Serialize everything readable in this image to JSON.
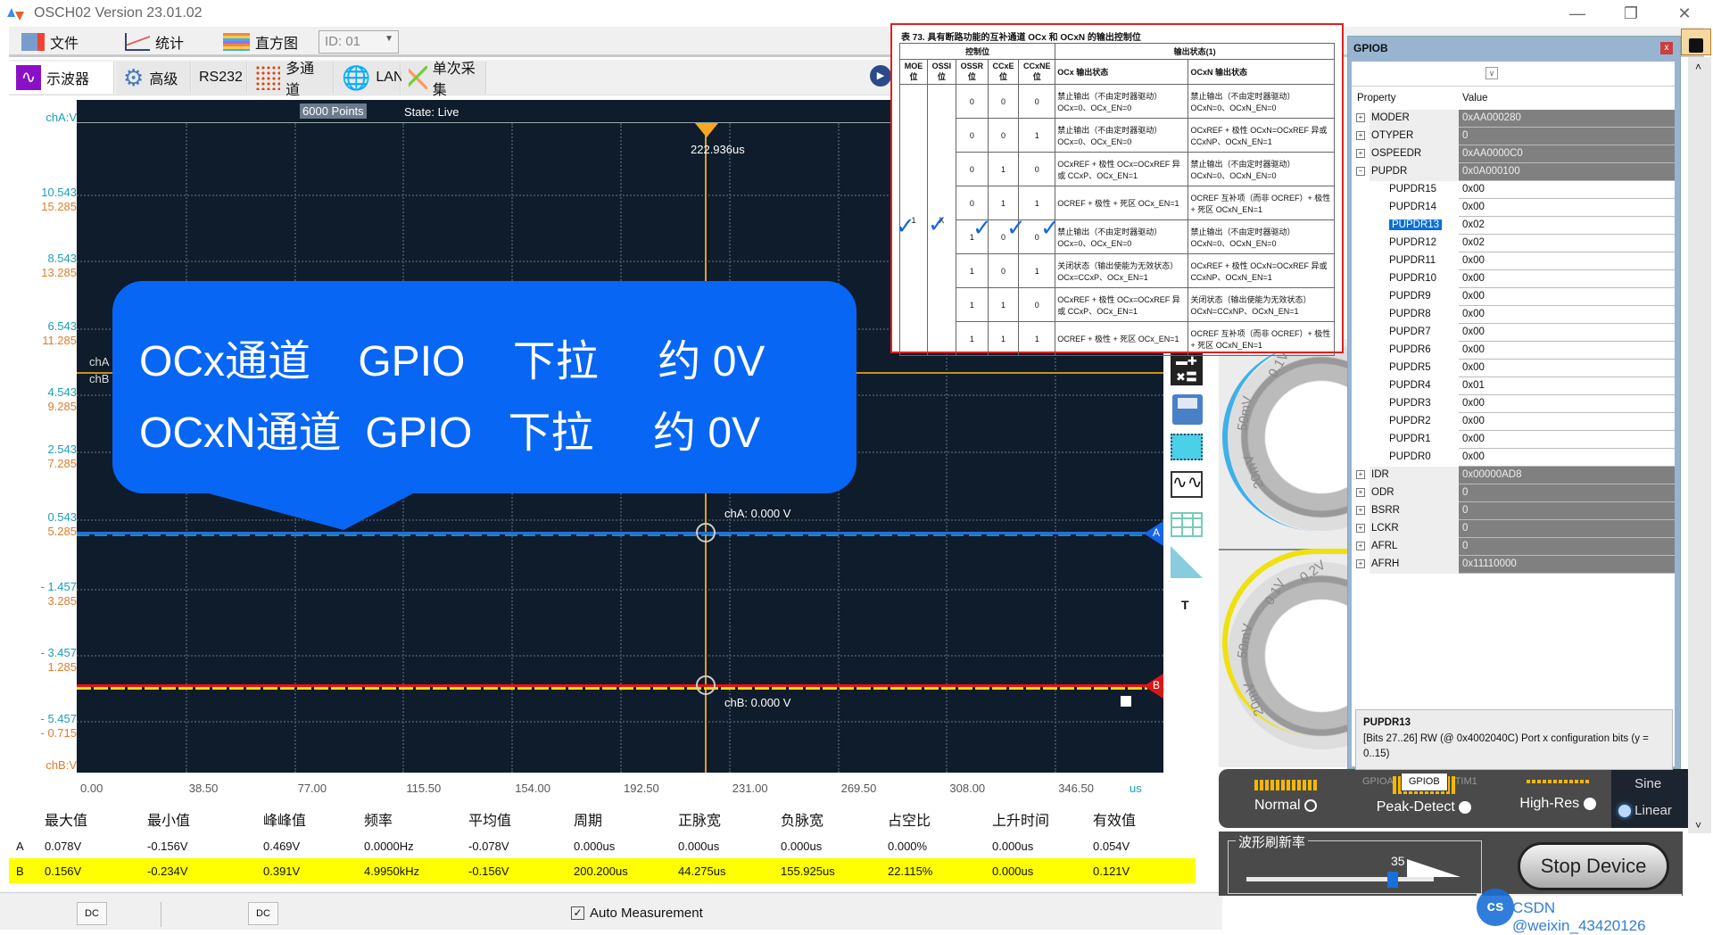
{
  "window": {
    "title": "OSCH02  Version 23.01.02"
  },
  "menu": {
    "items": [
      {
        "label": "文件",
        "icon": "file-icon"
      },
      {
        "label": "统计",
        "icon": "chart-icon"
      },
      {
        "label": "直方图",
        "icon": "histogram-icon"
      }
    ],
    "id_select": "ID: 01"
  },
  "tabs": [
    {
      "label": "示波器",
      "icon": "oscilloscope-icon",
      "active": true
    },
    {
      "label": "高级",
      "icon": "gear-icon"
    },
    {
      "label": "RS232",
      "icon": ""
    },
    {
      "label": "多通道",
      "icon": "grid-icon"
    },
    {
      "label": "LAN",
      "icon": "globe-icon"
    },
    {
      "label": "单次采集",
      "icon": "single-capture-icon"
    }
  ],
  "scope": {
    "points": "6000 Points",
    "state": "State: Live",
    "trigger_time": "222.936us",
    "chA_label": "chA",
    "chB_label": "chB",
    "chA_readout": "chA: 0.000 V",
    "chB_readout": "chB: 0.000 V",
    "marker_a": "A",
    "marker_b": "B",
    "y_axis_a_title": "chA:V",
    "y_axis_b_title": "chB:V",
    "y_ticks_a": [
      "10.543",
      "8.543",
      "6.543",
      "4.543",
      "2.543",
      "0.543",
      "- 1.457",
      "- 3.457",
      "- 5.457"
    ],
    "y_ticks_b": [
      "15.285",
      "13.285",
      "11.285",
      "9.285",
      "7.285",
      "5.285",
      "3.285",
      "1.285",
      "- 0.715"
    ],
    "x_ticks": [
      "0.00",
      "38.50",
      "77.00",
      "115.50",
      "154.00",
      "192.50",
      "231.00",
      "269.50",
      "308.00",
      "346.50"
    ],
    "x_unit": "us"
  },
  "annotation": {
    "line1": "OCx通道    GPIO    下拉     约 0V",
    "line2": "OCxN通道  GPIO   下拉     约 0V"
  },
  "measurements": {
    "headers": [
      "最大值",
      "最小值",
      "峰峰值",
      "频率",
      "平均值",
      "周期",
      "正脉宽",
      "负脉宽",
      "占空比",
      "上升时间",
      "有效值"
    ],
    "rows": [
      {
        "ch": "A",
        "values": [
          "0.078V",
          "-0.156V",
          "0.469V",
          "0.0000Hz",
          "-0.078V",
          "0.000us",
          "0.000us",
          "0.000us",
          "0.000%",
          "0.000us",
          "0.054V"
        ]
      },
      {
        "ch": "B",
        "values": [
          "0.156V",
          "-0.234V",
          "0.391V",
          "4.9950kHz",
          "-0.156V",
          "200.200us",
          "44.275us",
          "155.925us",
          "22.115%",
          "0.000us",
          "0.121V"
        ]
      }
    ]
  },
  "bottom": {
    "coupling_a": "DC",
    "coupling_b": "DC",
    "auto_measurement": "Auto Measurement",
    "auto_checked": "✓"
  },
  "knobs": {
    "a": {
      "labels": [
        "0.1V",
        "50mV",
        "20mV"
      ],
      "color": "#3fb0e8"
    },
    "b": {
      "labels": [
        "0.2V",
        "0.1V",
        "50mV",
        "20mV"
      ],
      "color": "#f0e010"
    }
  },
  "acquisition": {
    "modes": [
      "Normal",
      "Peak-Detect",
      "High-Res"
    ],
    "interp": [
      "Sine",
      "Linear"
    ]
  },
  "refresh": {
    "label": "波形刷新率",
    "value": "35",
    "stop_button": "Stop Device"
  },
  "side_tools": {
    "t_label": "T"
  },
  "datasheet": {
    "caption": "表 73.        具有断路功能的互补通道 OCx 和 OCxN 的输出控制位",
    "group_ctrl": "控制位",
    "group_out": "输出状态(1)",
    "cols": [
      "MOE 位",
      "OSSI 位",
      "OSSR 位",
      "CCxE 位",
      "CCxNE 位",
      "OCx 输出状态",
      "OCxN 输出状态"
    ],
    "moe": "1",
    "ossi": "X",
    "rows": [
      {
        "ossr": "0",
        "ccxe": "0",
        "ccxne": "0",
        "ocx": "禁止输出（不由定时器驱动） OCx=0、OCx_EN=0",
        "ocxn": "禁止输出（不由定时器驱动） OCxN=0、OCxN_EN=0"
      },
      {
        "ossr": "0",
        "ccxe": "0",
        "ccxne": "1",
        "ocx": "禁止输出（不由定时器驱动） OCx=0、OCx_EN=0",
        "ocxn": "OCxREF + 极性 OCxN=OCxREF 异或 CCxNP、OCxN_EN=1"
      },
      {
        "ossr": "0",
        "ccxe": "1",
        "ccxne": "0",
        "ocx": "OCxREF + 极性 OCx=OCxREF 异或 CCxP、OCx_EN=1",
        "ocxn": "禁止输出（不由定时器驱动） OCxN=0、OCxN_EN=0"
      },
      {
        "ossr": "0",
        "ccxe": "1",
        "ccxne": "1",
        "ocx": "OCREF + 极性 + 死区 OCx_EN=1",
        "ocxn": "OCREF 互补项（而非 OCREF）+ 极性 + 死区 OCxN_EN=1"
      },
      {
        "ossr": "1",
        "ccxe": "0",
        "ccxne": "0",
        "ocx": "禁止输出（不由定时器驱动） OCx=0、OCx_EN=0",
        "ocxn": "禁止输出（不由定时器驱动） OCxN=0、OCxN_EN=0"
      },
      {
        "ossr": "1",
        "ccxe": "0",
        "ccxne": "1",
        "ocx": "关闭状态（输出使能为无效状态） OCx=CCxP、OCx_EN=1",
        "ocxn": "OCxREF + 极性 OCxN=OCxREF 异或 CCxNP、OCxN_EN=1"
      },
      {
        "ossr": "1",
        "ccxe": "1",
        "ccxne": "0",
        "ocx": "OCxREF + 极性 OCx=OCxREF 异或 CCxP、OCx_EN=1",
        "ocxn": "关闭状态（输出使能为无效状态） OCxN=CCxNP、OCxN_EN=1"
      },
      {
        "ossr": "1",
        "ccxe": "1",
        "ccxne": "1",
        "ocx": "OCREF + 极性 + 死区 OCx_EN=1",
        "ocxn": "OCREF 互补项（而非 OCREF）+ 极性 + 死区 OCxN_EN=1"
      }
    ]
  },
  "gpio_panel": {
    "title": "GPIOB",
    "col_property": "Property",
    "col_value": "Value",
    "registers": [
      {
        "name": "MODER",
        "value": "0xAA000280",
        "expanded": false
      },
      {
        "name": "OTYPER",
        "value": "0",
        "expanded": false
      },
      {
        "name": "OSPEEDR",
        "value": "0xAA0000C0",
        "expanded": false
      },
      {
        "name": "PUPDR",
        "value": "0x0A000100",
        "expanded": true,
        "children": [
          {
            "name": "PUPDR15",
            "value": "0x00"
          },
          {
            "name": "PUPDR14",
            "value": "0x00"
          },
          {
            "name": "PUPDR13",
            "value": "0x02",
            "selected": true
          },
          {
            "name": "PUPDR12",
            "value": "0x02"
          },
          {
            "name": "PUPDR11",
            "value": "0x00"
          },
          {
            "name": "PUPDR10",
            "value": "0x00"
          },
          {
            "name": "PUPDR9",
            "value": "0x00"
          },
          {
            "name": "PUPDR8",
            "value": "0x00"
          },
          {
            "name": "PUPDR7",
            "value": "0x00"
          },
          {
            "name": "PUPDR6",
            "value": "0x00"
          },
          {
            "name": "PUPDR5",
            "value": "0x00"
          },
          {
            "name": "PUPDR4",
            "value": "0x01"
          },
          {
            "name": "PUPDR3",
            "value": "0x00"
          },
          {
            "name": "PUPDR2",
            "value": "0x00"
          },
          {
            "name": "PUPDR1",
            "value": "0x00"
          },
          {
            "name": "PUPDR0",
            "value": "0x00"
          }
        ]
      },
      {
        "name": "IDR",
        "value": "0x00000AD8",
        "expanded": false
      },
      {
        "name": "ODR",
        "value": "0",
        "expanded": false
      },
      {
        "name": "BSRR",
        "value": "0",
        "expanded": false
      },
      {
        "name": "LCKR",
        "value": "0",
        "expanded": false
      },
      {
        "name": "AFRL",
        "value": "0",
        "expanded": false
      },
      {
        "name": "AFRH",
        "value": "0x11110000",
        "expanded": false
      }
    ],
    "desc_title": "PUPDR13",
    "desc_text": "[Bits 27..26] RW (@ 0x4002040C) Port x configuration bits (y = 0..15)",
    "tabs": [
      "GPIOA",
      "GPIOB",
      "TIM1"
    ],
    "active_tab": "GPIOB"
  },
  "watermark": "CSDN @weixin_43420126"
}
